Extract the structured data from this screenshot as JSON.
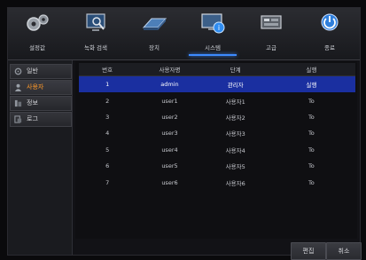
{
  "toolbar": {
    "items": [
      {
        "label": "설정값",
        "icon": "gear-icon"
      },
      {
        "label": "녹화 검색",
        "icon": "search-monitor-icon"
      },
      {
        "label": "장치",
        "icon": "device-drive-icon"
      },
      {
        "label": "시스템",
        "icon": "system-info-icon"
      },
      {
        "label": "고급",
        "icon": "advanced-icon"
      },
      {
        "label": "종료",
        "icon": "power-icon"
      }
    ],
    "active_index": 3
  },
  "sidebar": {
    "items": [
      {
        "label": "일반",
        "icon": "gear-small-icon"
      },
      {
        "label": "사용자",
        "icon": "user-icon"
      },
      {
        "label": "정보",
        "icon": "info-icon"
      },
      {
        "label": "로그",
        "icon": "log-icon"
      }
    ],
    "active_index": 1
  },
  "table": {
    "headers": [
      "번호",
      "사용자명",
      "단계",
      "실행"
    ],
    "rows": [
      [
        "1",
        "admin",
        "관리자",
        "실행"
      ],
      [
        "2",
        "user1",
        "사용자1",
        "To"
      ],
      [
        "3",
        "user2",
        "사용자2",
        "To"
      ],
      [
        "4",
        "user3",
        "사용자3",
        "To"
      ],
      [
        "5",
        "user4",
        "사용자4",
        "To"
      ],
      [
        "6",
        "user5",
        "사용자5",
        "To"
      ],
      [
        "7",
        "user6",
        "사용자6",
        "To"
      ]
    ],
    "selected_row": 0
  },
  "buttons": {
    "edit_label": "편집",
    "cancel_label": "취소"
  },
  "colors": {
    "accent": "#3d8bff",
    "selection": "#1a2fa0",
    "active_side_text": "#ff9a2a"
  }
}
